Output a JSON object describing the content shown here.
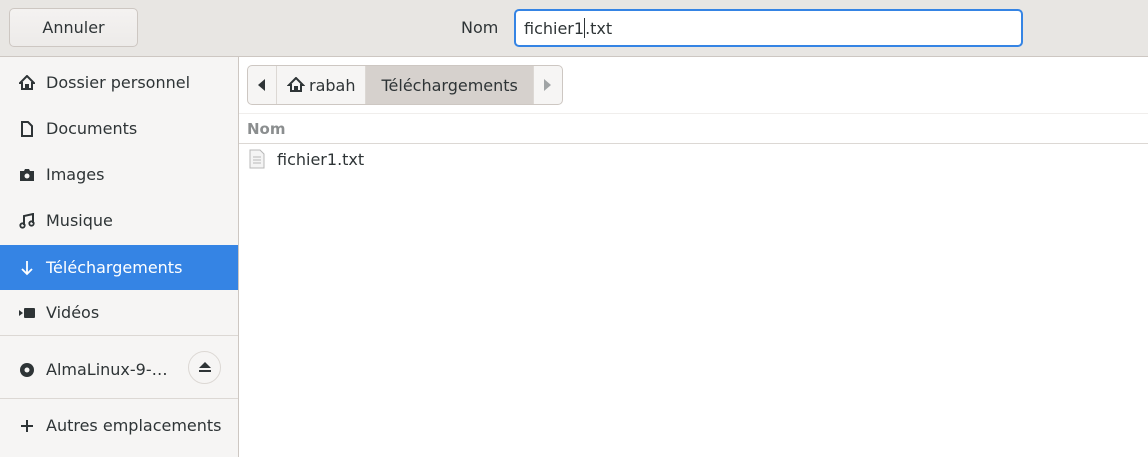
{
  "header": {
    "cancel_label": "Annuler",
    "name_label": "Nom",
    "filename_before_caret": "fichier1",
    "filename_after_caret": ".txt"
  },
  "sidebar": {
    "items": [
      {
        "label": "Dossier personnel",
        "icon": "home-icon"
      },
      {
        "label": "Documents",
        "icon": "document-icon"
      },
      {
        "label": "Images",
        "icon": "camera-icon"
      },
      {
        "label": "Musique",
        "icon": "music-icon"
      },
      {
        "label": "Téléchargements",
        "icon": "download-icon",
        "selected": true
      },
      {
        "label": "Vidéos",
        "icon": "video-icon"
      }
    ],
    "volume": {
      "label": "AlmaLinux-9-…",
      "icon": "disc-icon"
    },
    "other": {
      "label": "Autres emplacements",
      "icon": "plus-icon"
    }
  },
  "pathbar": {
    "home": "rabah",
    "current": "Téléchargements"
  },
  "list": {
    "column": "Nom",
    "files": [
      {
        "name": "fichier1.txt"
      }
    ]
  },
  "colors": {
    "accent": "#3584e4"
  }
}
